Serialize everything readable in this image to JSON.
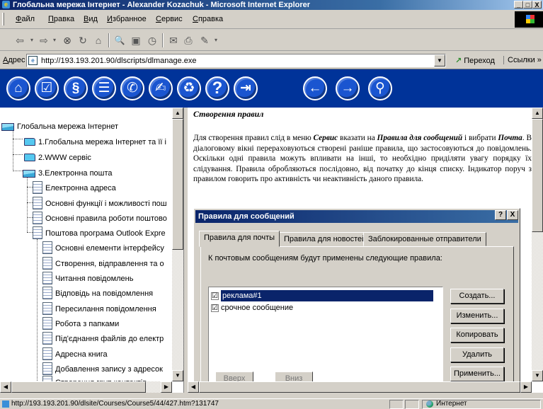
{
  "window": {
    "title": "Глобальна мережа Інтернет - Alexander Kozachuk - Microsoft Internet Explorer",
    "controls": [
      "_",
      "□",
      "X"
    ]
  },
  "menu": {
    "items": [
      "Файл",
      "Правка",
      "Вид",
      "Избранное",
      "Сервис",
      "Справка"
    ]
  },
  "toolbar": {
    "buttons": [
      {
        "name": "back-icon",
        "glyph": "⇦"
      },
      {
        "name": "forward-icon",
        "glyph": "⇨"
      },
      {
        "name": "stop-icon",
        "glyph": "⊗"
      },
      {
        "name": "refresh-icon",
        "glyph": "↻"
      },
      {
        "name": "home-icon",
        "glyph": "⌂"
      },
      {
        "name": "search-icon",
        "glyph": "🔍"
      },
      {
        "name": "favorites-icon",
        "glyph": "▣"
      },
      {
        "name": "history-icon",
        "glyph": "◷"
      },
      {
        "name": "mail-icon",
        "glyph": "✉"
      },
      {
        "name": "print-icon",
        "glyph": "⎙"
      },
      {
        "name": "edit-icon",
        "glyph": "✎"
      }
    ]
  },
  "address": {
    "label": "Адрес",
    "url": "http://193.193.201.90/dlscripts/dlmanage.exe",
    "go_label": "Переход",
    "links_label": "Ссылки »"
  },
  "nav_icons": [
    {
      "name": "home-nav-icon",
      "glyph": "⌂"
    },
    {
      "name": "checklist-nav-icon",
      "glyph": "☑"
    },
    {
      "name": "scroll-nav-icon",
      "glyph": "§"
    },
    {
      "name": "books-nav-icon",
      "glyph": "☰"
    },
    {
      "name": "chat-nav-icon",
      "glyph": "✆"
    },
    {
      "name": "pen-nav-icon",
      "glyph": "✍"
    },
    {
      "name": "recycle-nav-icon",
      "glyph": "♻"
    },
    {
      "name": "help-nav-icon",
      "glyph": "?"
    },
    {
      "name": "exit-nav-icon",
      "glyph": "⇥"
    },
    {
      "name": "prev-nav-icon",
      "glyph": "←"
    },
    {
      "name": "next-nav-icon",
      "glyph": "→"
    },
    {
      "name": "search-nav-icon",
      "glyph": "⚲"
    }
  ],
  "tree": {
    "items": [
      {
        "label": "Глобальна мережа Інтернет",
        "icon": "folder-open"
      },
      {
        "label": "1.Глобальна мережа Інтернет та її і",
        "icon": "folder"
      },
      {
        "label": "2.WWW сервіс",
        "icon": "folder"
      },
      {
        "label": "3.Електронна пошта",
        "icon": "folder-open"
      },
      {
        "label": "Електронна адреса",
        "icon": "doc"
      },
      {
        "label": "Основні функції і можливості пош",
        "icon": "doc"
      },
      {
        "label": "Основні правила роботи поштово",
        "icon": "doc"
      },
      {
        "label": "Поштова програма Outlook Expre",
        "icon": "doc"
      },
      {
        "label": "Основні елементи інтерфейсу",
        "icon": "doc"
      },
      {
        "label": "Створення, відправлення та о",
        "icon": "doc"
      },
      {
        "label": "Читання повідомлень",
        "icon": "doc"
      },
      {
        "label": "Відповідь на повідомлення",
        "icon": "doc"
      },
      {
        "label": "Пересилання повідомлення",
        "icon": "doc"
      },
      {
        "label": "Робота з папками",
        "icon": "doc"
      },
      {
        "label": "Під'єднання файлів до електр",
        "icon": "doc"
      },
      {
        "label": "Адресна книга",
        "icon": "doc"
      },
      {
        "label": "Добавлення запису з адресок",
        "icon": "doc"
      },
      {
        "label": "Створення груп контактів",
        "icon": "doc"
      }
    ]
  },
  "content": {
    "title": "Створення правил",
    "paragraph_parts": [
      {
        "t": "Для створення правил слід в меню ",
        "s": "n"
      },
      {
        "t": "Сервис",
        "s": "bi"
      },
      {
        "t": " вказати на ",
        "s": "n"
      },
      {
        "t": "Правила для сообщений",
        "s": "bi"
      },
      {
        "t": " і вибрати ",
        "s": "n"
      },
      {
        "t": "Почта",
        "s": "bi"
      },
      {
        "t": ". В діалоговому вікні перераховуються створені раніше правила, що застосовуються до повідомлень. Оскільки одні правила можуть впливати на інші, то необхідно приділяти увагу порядку їх слідування. Правила обробляються послідовно, від початку до кінця списку. Індикатор поруч з правилом говорить про активність чи неактивність даного правила.",
        "s": "n"
      }
    ]
  },
  "dialog": {
    "title": "Правила для сообщений",
    "help_button": "?",
    "close_button": "X",
    "tabs": [
      "Правила для почты",
      "Правила для новостей",
      "Заблокированные отправители"
    ],
    "hint": "К почтовым сообщениям будут применены следующие правила:",
    "rules": [
      {
        "label": "реклама#1",
        "checked": "☑"
      },
      {
        "label": "срочное сообщение",
        "checked": "☑"
      }
    ],
    "buttons": [
      "Создать...",
      "Изменить...",
      "Копировать",
      "Удалить",
      "Применить..."
    ],
    "bottom_buttons": [
      "Вверх",
      "Вниз"
    ]
  },
  "status": {
    "url": "http://193.193.201.90/dlsite/Courses/Course5/44/427.htm?131747",
    "zone": "Интернет"
  }
}
